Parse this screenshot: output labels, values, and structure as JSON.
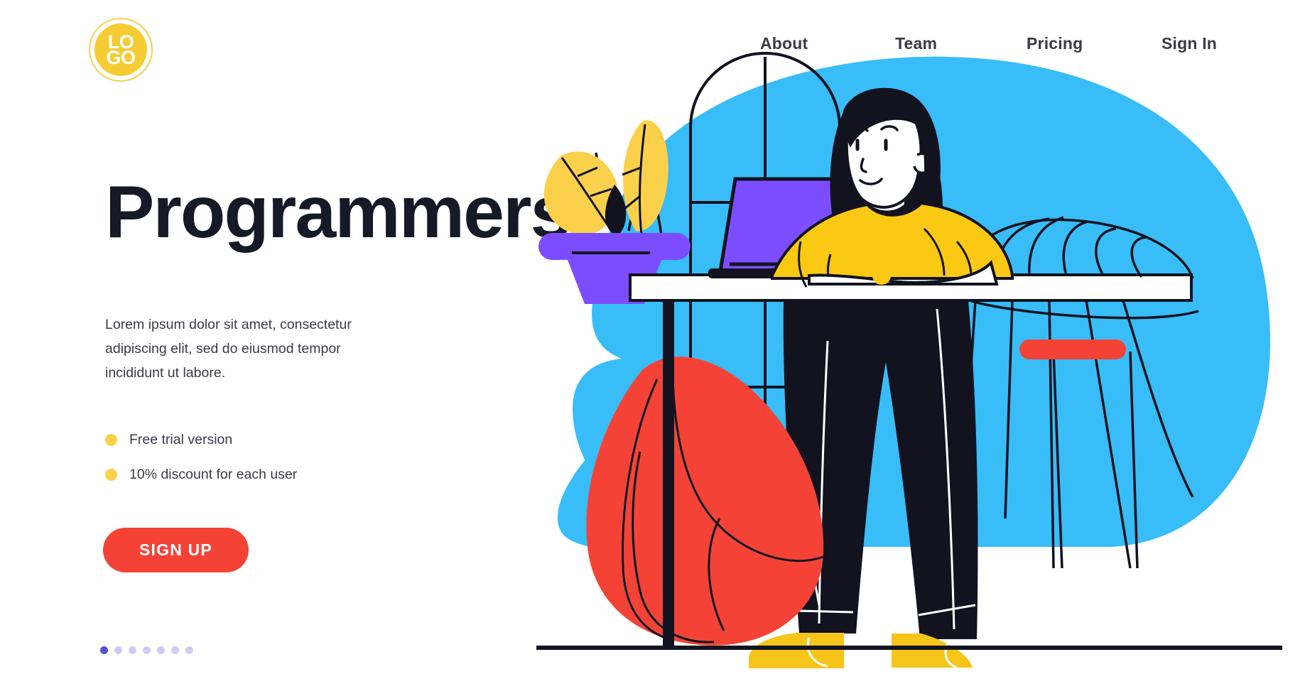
{
  "brand": {
    "logo_line1": "LO",
    "logo_line2": "GO",
    "logo_ring_color": "#f5d24a",
    "logo_fill_color": "#f5cc33"
  },
  "nav": {
    "items": [
      {
        "label": "About"
      },
      {
        "label": "Team"
      },
      {
        "label": "Pricing"
      },
      {
        "label": "Sign In"
      }
    ]
  },
  "hero": {
    "title": "Programmers",
    "paragraph": "Lorem ipsum dolor sit amet, consectetur adipiscing elit, sed do eiusmod tempor incididunt ut labore.",
    "features": [
      {
        "label": "Free trial version"
      },
      {
        "label": "10% discount for each user"
      }
    ],
    "cta_label": "SIGN UP",
    "cta_color": "#f44336",
    "bullet_color": "#fbd04b",
    "title_color": "#161a26"
  },
  "carousel": {
    "total": 7,
    "active_index": 0,
    "active_color": "#5b4fd6",
    "inactive_color": "#cfcbf5"
  },
  "illustration": {
    "name": "woman-programmer-at-desk-with-laptop",
    "colors": {
      "blob": "#38bdf8",
      "laptop": "#7c4dff",
      "plant_pot": "#7c4dff",
      "leaves": "#fbd04b",
      "shirt": "#fbc913",
      "trousers": "#12131f",
      "hair": "#12131f",
      "shoes": "#f7c41a",
      "beanbag": "#f44336",
      "armrest": "#f44336",
      "desk": "#ffffff",
      "outline": "#12131f",
      "skin": "#ffffff"
    },
    "elements": [
      "cyan-background-blob",
      "arched-window",
      "potted-plant",
      "purple-laptop",
      "white-desk",
      "seated-woman",
      "wireframe-chair",
      "red-beanbag",
      "floor-line"
    ]
  }
}
